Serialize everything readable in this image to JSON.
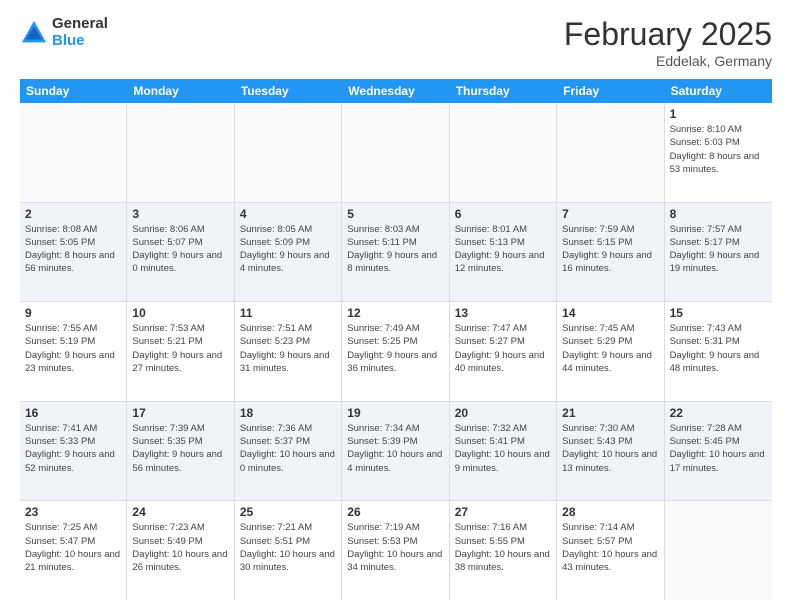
{
  "logo": {
    "general": "General",
    "blue": "Blue"
  },
  "header": {
    "month": "February 2025",
    "location": "Eddelak, Germany"
  },
  "weekdays": [
    "Sunday",
    "Monday",
    "Tuesday",
    "Wednesday",
    "Thursday",
    "Friday",
    "Saturday"
  ],
  "rows": [
    [
      {
        "day": "",
        "info": ""
      },
      {
        "day": "",
        "info": ""
      },
      {
        "day": "",
        "info": ""
      },
      {
        "day": "",
        "info": ""
      },
      {
        "day": "",
        "info": ""
      },
      {
        "day": "",
        "info": ""
      },
      {
        "day": "1",
        "info": "Sunrise: 8:10 AM\nSunset: 5:03 PM\nDaylight: 8 hours and 53 minutes."
      }
    ],
    [
      {
        "day": "2",
        "info": "Sunrise: 8:08 AM\nSunset: 5:05 PM\nDaylight: 8 hours and 56 minutes."
      },
      {
        "day": "3",
        "info": "Sunrise: 8:06 AM\nSunset: 5:07 PM\nDaylight: 9 hours and 0 minutes."
      },
      {
        "day": "4",
        "info": "Sunrise: 8:05 AM\nSunset: 5:09 PM\nDaylight: 9 hours and 4 minutes."
      },
      {
        "day": "5",
        "info": "Sunrise: 8:03 AM\nSunset: 5:11 PM\nDaylight: 9 hours and 8 minutes."
      },
      {
        "day": "6",
        "info": "Sunrise: 8:01 AM\nSunset: 5:13 PM\nDaylight: 9 hours and 12 minutes."
      },
      {
        "day": "7",
        "info": "Sunrise: 7:59 AM\nSunset: 5:15 PM\nDaylight: 9 hours and 16 minutes."
      },
      {
        "day": "8",
        "info": "Sunrise: 7:57 AM\nSunset: 5:17 PM\nDaylight: 9 hours and 19 minutes."
      }
    ],
    [
      {
        "day": "9",
        "info": "Sunrise: 7:55 AM\nSunset: 5:19 PM\nDaylight: 9 hours and 23 minutes."
      },
      {
        "day": "10",
        "info": "Sunrise: 7:53 AM\nSunset: 5:21 PM\nDaylight: 9 hours and 27 minutes."
      },
      {
        "day": "11",
        "info": "Sunrise: 7:51 AM\nSunset: 5:23 PM\nDaylight: 9 hours and 31 minutes."
      },
      {
        "day": "12",
        "info": "Sunrise: 7:49 AM\nSunset: 5:25 PM\nDaylight: 9 hours and 36 minutes."
      },
      {
        "day": "13",
        "info": "Sunrise: 7:47 AM\nSunset: 5:27 PM\nDaylight: 9 hours and 40 minutes."
      },
      {
        "day": "14",
        "info": "Sunrise: 7:45 AM\nSunset: 5:29 PM\nDaylight: 9 hours and 44 minutes."
      },
      {
        "day": "15",
        "info": "Sunrise: 7:43 AM\nSunset: 5:31 PM\nDaylight: 9 hours and 48 minutes."
      }
    ],
    [
      {
        "day": "16",
        "info": "Sunrise: 7:41 AM\nSunset: 5:33 PM\nDaylight: 9 hours and 52 minutes."
      },
      {
        "day": "17",
        "info": "Sunrise: 7:39 AM\nSunset: 5:35 PM\nDaylight: 9 hours and 56 minutes."
      },
      {
        "day": "18",
        "info": "Sunrise: 7:36 AM\nSunset: 5:37 PM\nDaylight: 10 hours and 0 minutes."
      },
      {
        "day": "19",
        "info": "Sunrise: 7:34 AM\nSunset: 5:39 PM\nDaylight: 10 hours and 4 minutes."
      },
      {
        "day": "20",
        "info": "Sunrise: 7:32 AM\nSunset: 5:41 PM\nDaylight: 10 hours and 9 minutes."
      },
      {
        "day": "21",
        "info": "Sunrise: 7:30 AM\nSunset: 5:43 PM\nDaylight: 10 hours and 13 minutes."
      },
      {
        "day": "22",
        "info": "Sunrise: 7:28 AM\nSunset: 5:45 PM\nDaylight: 10 hours and 17 minutes."
      }
    ],
    [
      {
        "day": "23",
        "info": "Sunrise: 7:25 AM\nSunset: 5:47 PM\nDaylight: 10 hours and 21 minutes."
      },
      {
        "day": "24",
        "info": "Sunrise: 7:23 AM\nSunset: 5:49 PM\nDaylight: 10 hours and 26 minutes."
      },
      {
        "day": "25",
        "info": "Sunrise: 7:21 AM\nSunset: 5:51 PM\nDaylight: 10 hours and 30 minutes."
      },
      {
        "day": "26",
        "info": "Sunrise: 7:19 AM\nSunset: 5:53 PM\nDaylight: 10 hours and 34 minutes."
      },
      {
        "day": "27",
        "info": "Sunrise: 7:16 AM\nSunset: 5:55 PM\nDaylight: 10 hours and 38 minutes."
      },
      {
        "day": "28",
        "info": "Sunrise: 7:14 AM\nSunset: 5:57 PM\nDaylight: 10 hours and 43 minutes."
      },
      {
        "day": "",
        "info": ""
      }
    ]
  ]
}
